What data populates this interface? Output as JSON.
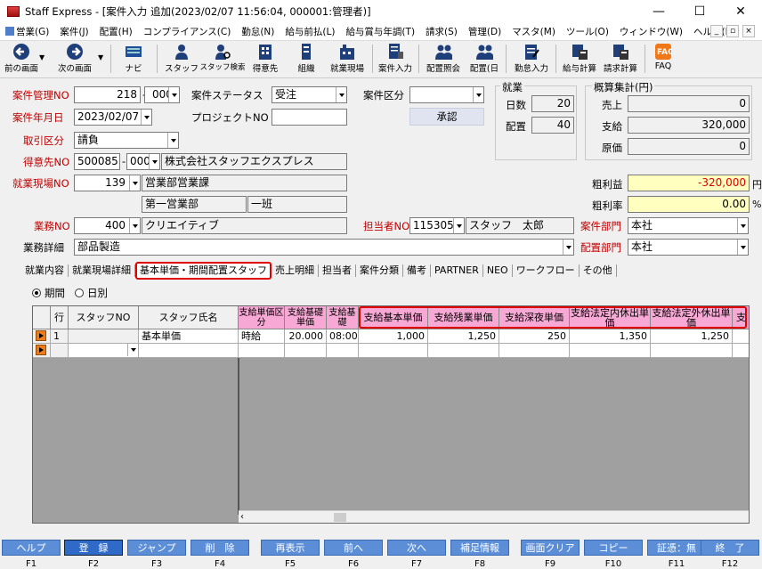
{
  "window": {
    "title": "Staff Express - [案件入力  追加(2023/02/07 11:56:04, 000001:管理者)]",
    "min": "—",
    "max": "☐",
    "close": "✕"
  },
  "menu": [
    "営業(G)",
    "案件(J)",
    "配置(H)",
    "コンプライアンス(C)",
    "勤怠(N)",
    "給与前払(L)",
    "給与賞与年調(T)",
    "請求(S)",
    "管理(D)",
    "マスタ(M)",
    "ツール(O)",
    "ウィンドウ(W)",
    "ヘルプ(H)"
  ],
  "toolbar": {
    "prev": "前の画面",
    "next": "次の画面",
    "navi": "ナビ",
    "staff": "スタッフ",
    "staff_search": "スタッフ検索",
    "client": "得意先",
    "org": "組織",
    "site": "就業現場",
    "case_input": "案件入力",
    "assign_query": "配置照会",
    "assign_day": "配置(日",
    "attendance": "勤怠入力",
    "payroll": "給与計算",
    "billing": "請求計算",
    "faq": "FAQ"
  },
  "form": {
    "case_no_label": "案件管理NO",
    "case_no": "218",
    "case_no_sub": "000",
    "status_label": "案件ステータス",
    "status": "受注",
    "case_kind_label": "案件区分",
    "case_kind": "",
    "approve": "承認",
    "date_label": "案件年月日",
    "date": "2023/02/07",
    "project_label": "プロジェクトNO",
    "project": "",
    "trade_label": "取引区分",
    "trade": "請負",
    "client_label": "得意先NO",
    "client_no": "500085",
    "client_sub": "000",
    "client_name": "株式会社スタッフエクスプレス",
    "site_label": "就業現場NO",
    "site_no": "139",
    "site_name": "営業部営業課",
    "site_dept": "第一営業部",
    "site_team": "一班",
    "business_label": "業務NO",
    "business_no": "400",
    "business_name": "クリエイティブ",
    "manager_label": "担当者NO",
    "manager_no": "115305",
    "manager_name": "スタッフ　太郎",
    "case_dept_label": "案件部門",
    "case_dept": "本社",
    "detail_label": "業務詳細",
    "detail": "部品製造",
    "assign_dept_label": "配置部門",
    "assign_dept": "本社"
  },
  "work": {
    "title": "就業",
    "days_label": "日数",
    "days": "20",
    "assign_label": "配置",
    "assign": "40"
  },
  "estimate": {
    "title": "概算集計(円)",
    "sales_label": "売上",
    "sales": "0",
    "pay_label": "支給",
    "pay": "320,000",
    "cost_label": "原価",
    "cost": "0",
    "gross_label": "粗利益",
    "gross": "-320,000",
    "gross_unit": "円",
    "rate_label": "粗利率",
    "rate": "0.00",
    "rate_unit": "%"
  },
  "tabs": [
    "就業内容",
    "就業現場詳細",
    "基本単価・期間配置スタッフ",
    "売上明細",
    "担当者",
    "案件分類",
    "備考",
    "PARTNER",
    "NEO",
    "ワークフロー",
    "その他"
  ],
  "radio": {
    "period": "期間",
    "daily": "日別"
  },
  "grid": {
    "headers": [
      "行",
      "スタッフNO",
      "スタッフ氏名",
      "支給単価区分",
      "支給基礎単価",
      "支給基礎",
      "支給基本単価",
      "支給残業単価",
      "支給深夜単価",
      "支給法定内休出単価",
      "支給法定外休出単価",
      "支"
    ],
    "row": {
      "no": "1",
      "staff_no": "",
      "name": "基本単価",
      "kubun": "時給",
      "base_price": "20.000",
      "base": "08:00",
      "basic": "1,000",
      "overtime": "1,250",
      "night": "250",
      "legal_in": "1,350",
      "legal_out": "1,250"
    }
  },
  "fkeys": [
    {
      "label": "ヘルプ",
      "key": "F1"
    },
    {
      "label": "登　録",
      "key": "F2"
    },
    {
      "label": "ジャンプ",
      "key": "F3"
    },
    {
      "label": "削　除",
      "key": "F4"
    },
    {
      "label": "再表示",
      "key": "F5"
    },
    {
      "label": "前へ",
      "key": "F6"
    },
    {
      "label": "次へ",
      "key": "F7"
    },
    {
      "label": "補足情報",
      "key": "F8"
    },
    {
      "label": "画面クリア",
      "key": "F9"
    },
    {
      "label": "コピー",
      "key": "F10"
    },
    {
      "label": "証憑：無",
      "key": "F11"
    },
    {
      "label": "終　了",
      "key": "F12"
    }
  ],
  "colors": {
    "red_label": "#c00000",
    "pink_header": "#f7a8d4",
    "fkey": "#5b8ed6",
    "highlight": "#ffffc0",
    "highlight_border": "#e00000"
  }
}
